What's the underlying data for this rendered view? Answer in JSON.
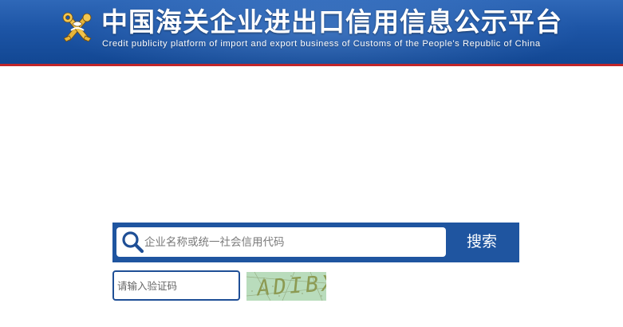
{
  "header": {
    "title": "中国海关企业进出口信用信息公示平台",
    "subtitle": "Credit publicity platform of import and export business of Customs of the People's Republic of China",
    "emblem_icon": "customs-emblem-icon"
  },
  "search": {
    "placeholder": "企业名称或统一社会信用代码",
    "value": "",
    "button_label": "搜索",
    "icon": "search-icon"
  },
  "captcha": {
    "placeholder": "请输入验证码",
    "value": "",
    "image_text": "ADIBX"
  },
  "colors": {
    "header_blue": "#1d55a6",
    "header_red_line": "#c0262a",
    "search_bar_blue": "#1f55a0",
    "captcha_bg": "#b9dcbc"
  }
}
